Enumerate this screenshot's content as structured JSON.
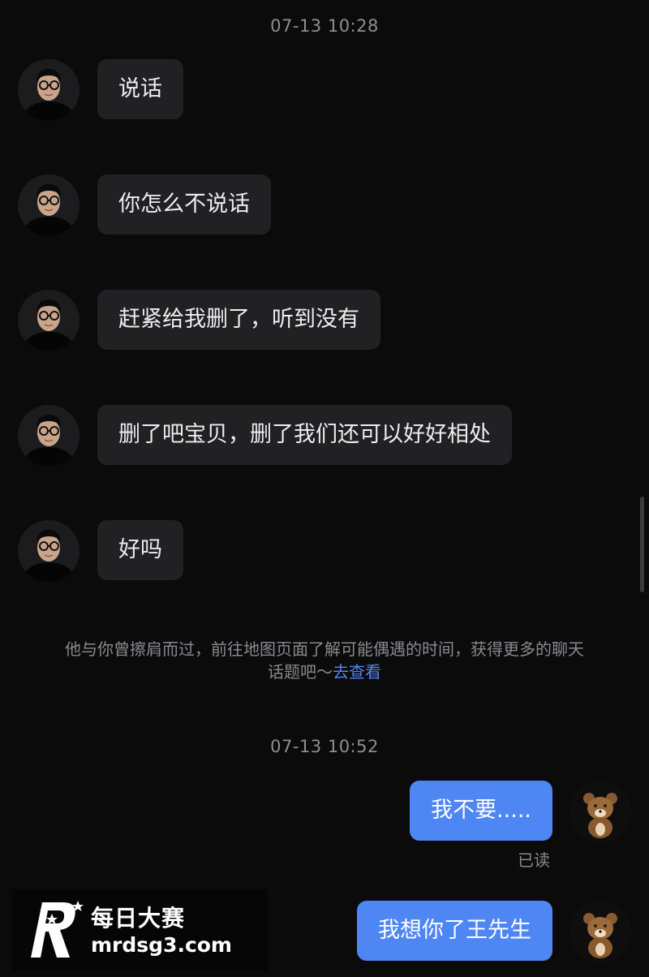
{
  "conversation": {
    "timestamps": [
      "07-13 10:28",
      "07-13 10:52"
    ],
    "incoming": [
      {
        "text": "说话"
      },
      {
        "text": "你怎么不说话"
      },
      {
        "text": "赶紧给我删了，听到没有"
      },
      {
        "text": "删了吧宝贝，删了我们还可以好好相处"
      },
      {
        "text": "好吗"
      }
    ],
    "notice": {
      "text": "他与你曾擦肩而过，前往地图页面了解可能偶遇的时间，获得更多的聊天话题吧～",
      "link": "去查看"
    },
    "outgoing": [
      {
        "text": "我不要....."
      },
      {
        "text": "我想你了王先生"
      }
    ],
    "read_receipt": "已读"
  },
  "watermark": {
    "name": "每日大赛",
    "url": "mrdsg3.com"
  },
  "colors": {
    "background": "#0b0b0c",
    "incoming_bubble": "#212123",
    "outgoing_bubble": "#4e86f3",
    "link": "#4e86f3",
    "muted_text": "#8a8a8e"
  },
  "icons": {
    "incoming_avatar": "man-with-glasses-avatar",
    "outgoing_avatar": "brown-bear-avatar"
  }
}
